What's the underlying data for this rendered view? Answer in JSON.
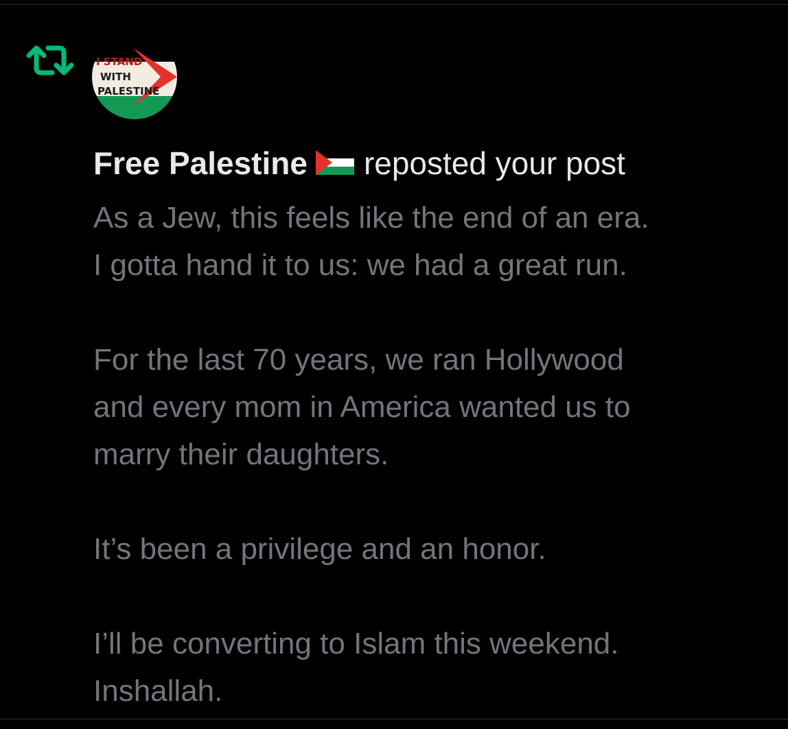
{
  "notification": {
    "type": "repost",
    "icon": "repost-icon",
    "avatar": {
      "icon": "palestine-flag-avatar",
      "text_lines": [
        "I STAND",
        "WITH",
        "PALESTINE"
      ]
    },
    "user_name": "Free Palestine",
    "user_badge": "palestine-flag-emoji",
    "action_text": "reposted your post"
  },
  "post": {
    "paragraphs": [
      [
        "As a Jew, this feels like the end of an era.",
        "I gotta hand it to us: we had a great run."
      ],
      [
        "For the last 70 years, we ran Hollywood",
        "and every mom in America wanted us to",
        "marry their daughters."
      ],
      [
        "It’s been a privilege and an honor."
      ],
      [
        "I’ll be converting to Islam this weekend.",
        "Inshallah."
      ]
    ]
  },
  "colors": {
    "background": "#000000",
    "primary_text": "#e7e9ea",
    "secondary_text": "#71767b",
    "repost_green": "#00ba7c",
    "divider": "#2f3336",
    "flag_black": "#000000",
    "flag_white": "#ffffff",
    "flag_green": "#149954",
    "flag_red": "#e4312b"
  }
}
